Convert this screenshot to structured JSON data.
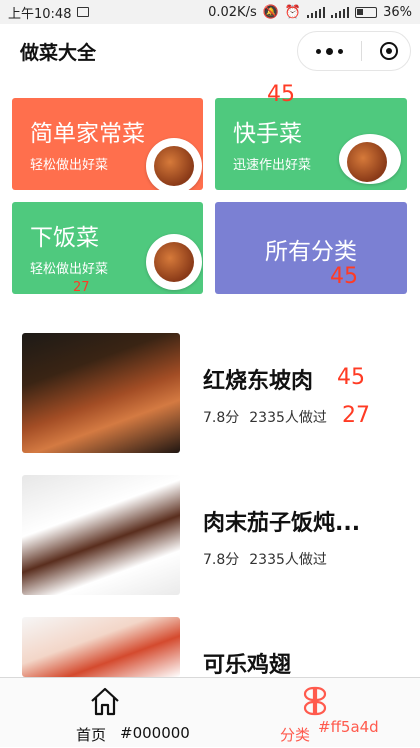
{
  "status": {
    "time": "上午10:48",
    "speed": "0.02K/s",
    "battery": "36%"
  },
  "header": {
    "title": "做菜大全"
  },
  "categories": [
    {
      "name": "简单家常菜",
      "sub": "轻松做出好菜",
      "color": "#ff6f4d"
    },
    {
      "name": "快手菜",
      "sub": "迅速作出好菜",
      "color": "#4fc97e"
    },
    {
      "name": "下饭菜",
      "sub": "轻松做出好菜",
      "color": "#4fc97e"
    },
    {
      "name": "所有分类",
      "sub": "",
      "color": "#7b80d3"
    }
  ],
  "overlays": {
    "a": "45",
    "b": "45",
    "c": "27",
    "d": "45",
    "e": "27"
  },
  "recipes": [
    {
      "name": "红烧东坡肉",
      "score": "7.8分",
      "count": "2335人做过"
    },
    {
      "name": "肉末茄子饭炖...",
      "score": "7.8分",
      "count": "2335人做过"
    },
    {
      "name": "可乐鸡翅",
      "score": "",
      "count": ""
    }
  ],
  "tabbar": {
    "home": "首页",
    "home_hint": "#000000",
    "category": "分类",
    "category_hint": "#ff5a4d",
    "active_color": "#ff5a4d"
  }
}
